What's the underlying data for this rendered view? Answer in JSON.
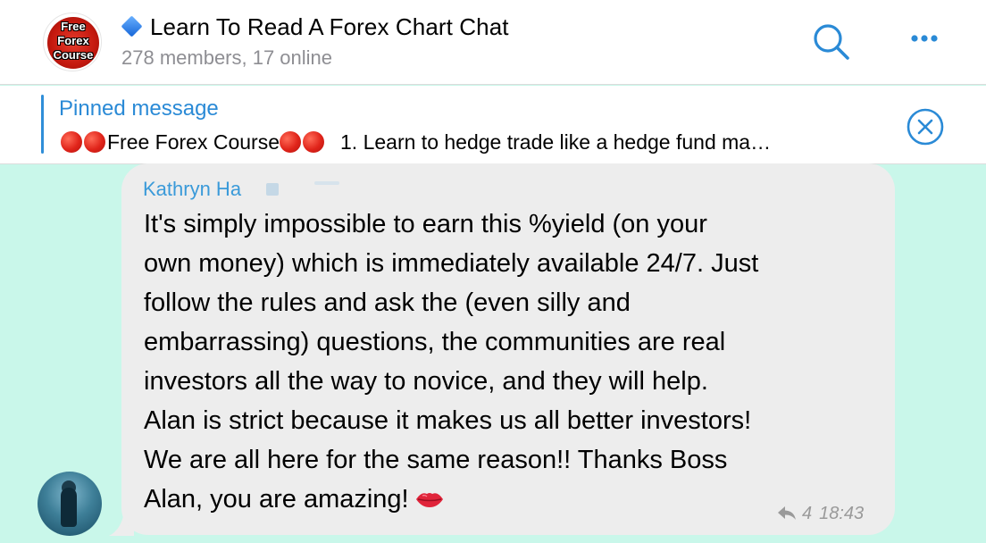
{
  "header": {
    "logo_text": [
      "Free",
      "Forex",
      "Course"
    ],
    "title": "Learn To Read A Forex Chart Chat",
    "title_icon": "blue-diamond-icon",
    "subtitle": "278 members, 17 online",
    "search_icon": "search-icon",
    "more_icon": "ellipsis-icon"
  },
  "pinned": {
    "label": "Pinned message",
    "text_part1": "Free Forex Course",
    "text_part2": "1. Learn to hedge trade like a hedge fund ma…",
    "close_icon": "close-circle-icon"
  },
  "message": {
    "sender": "Kathryn Ha",
    "lines": [
      "It's simply impossible to earn this %yield (on your",
      "own money) which is immediately available 24/7. Just",
      "follow the rules and ask the (even silly and",
      "embarrassing) questions, the communities are real",
      "investors all the way to novice, and they will help.",
      "Alan is strict because it makes us all better investors!",
      "We are all here for the same reason!! Thanks Boss",
      "Alan, you are amazing!"
    ],
    "emoji": "kiss-lips-icon",
    "reply_count": "4",
    "time": "18:43"
  },
  "colors": {
    "chat_background": "#c9f7ea",
    "bubble": "#ededed",
    "accent_blue": "#2a8ad6",
    "meta_gray": "#9a9a9a"
  }
}
